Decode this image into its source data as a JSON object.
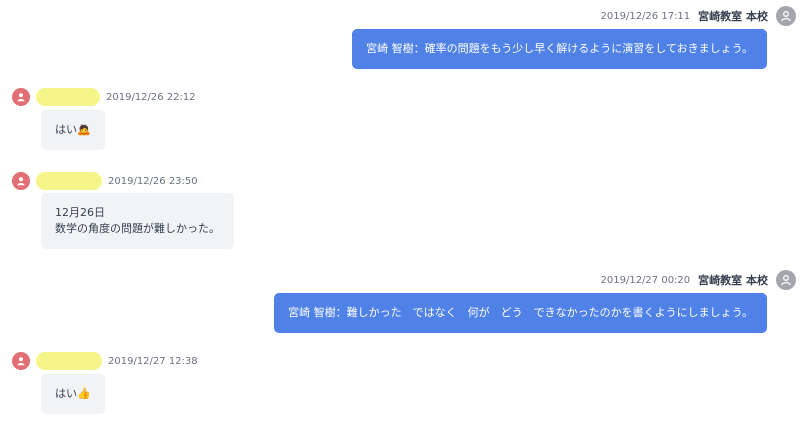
{
  "messages": [
    {
      "direction": "outgoing",
      "timestamp": "2019/12/26 17:11",
      "sender": "宮崎教室 本校",
      "text": "宮崎 智樹：確率の問題をもう少し早く解けるように演習をしておきましょう。"
    },
    {
      "direction": "incoming",
      "timestamp": "2019/12/26 22:12",
      "sender": "",
      "text": "はい",
      "emoji": "🙇"
    },
    {
      "direction": "incoming",
      "timestamp": "2019/12/26 23:50",
      "sender": "",
      "lines": [
        "12月26日",
        "数学の角度の問題が難しかった。"
      ]
    },
    {
      "direction": "outgoing",
      "timestamp": "2019/12/27 00:20",
      "sender": "宮崎教室 本校",
      "text": "宮崎 智樹：難しかった　ではなく　何が　どう　できなかったのかを書くようにしましょう。"
    },
    {
      "direction": "incoming",
      "timestamp": "2019/12/27 12:38",
      "sender": "",
      "text": "はい",
      "emoji": "👍"
    }
  ],
  "colors": {
    "outgoing_bubble": "#4f81e6",
    "incoming_bubble": "#f2f3f7",
    "student_avatar": "#e26f73",
    "teacher_avatar": "#a3a6ad",
    "name_redaction": "#f6f58a"
  },
  "icons": {
    "teacher_avatar": "user-icon",
    "student_avatar": "user-icon"
  }
}
